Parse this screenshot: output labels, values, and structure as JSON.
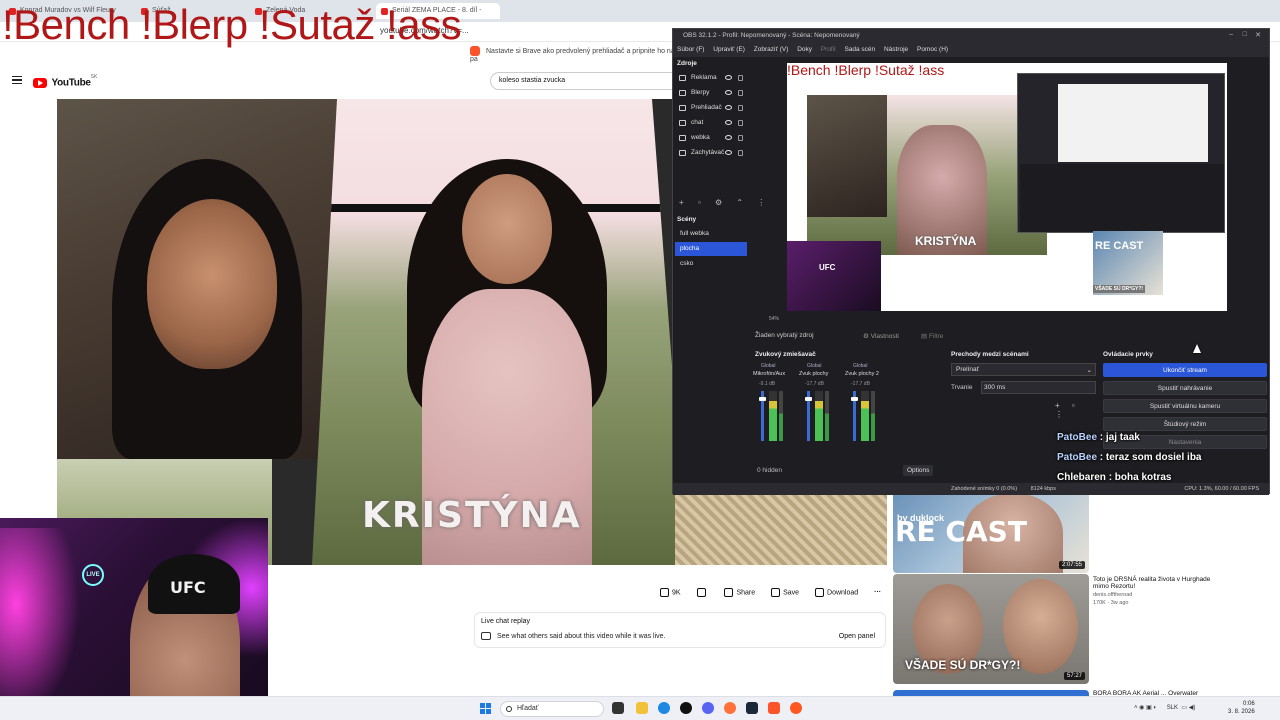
{
  "overlay_title": "!Bench !Blerp !Sutaž !ass",
  "browser": {
    "tabs": [
      {
        "label": "Konrad Muradov vs Wilf Fleury"
      },
      {
        "label": "Súťaž"
      },
      {
        "label": "Zelená Voda"
      },
      {
        "label": "jaro"
      },
      {
        "label": "Seriál ZEMA PLACE - 8. díl -"
      }
    ],
    "url": "youtube.com/watch?v=...",
    "infobar_text": "Nastavte si Brave ako predvolený prehliadač a pripnite ho na pa"
  },
  "youtube": {
    "logo_text": "YouTube",
    "logo_cc": "SK",
    "search_value": "koleso stastia zvucka",
    "video_overlay_name": "KRISTÝNA",
    "actions": {
      "likes": "9K",
      "share": "Share",
      "save": "Save",
      "download": "Download"
    },
    "chat_replay": {
      "title": "Live chat replay",
      "desc": "See what others said about this video while it was live.",
      "open": "Open panel"
    },
    "sidebar": [
      {
        "by": "by duklock",
        "big": "RE CAST",
        "duration": "2:07:55"
      },
      {
        "caption": "VŠADE SÚ DR*GY?!",
        "duration": "57:27",
        "title": "Toto je DRSNÁ realita života v Hurghade mimo Rezortu!",
        "channel": "denis.offtheroad",
        "meta": "170K · 3w ago"
      },
      {
        "title": "BORA BORA AK Aerial ... Overwater"
      }
    ]
  },
  "obs": {
    "title": "OBS 32.1.2 - Profil: Nepomenovaný - Scéna: Nepomenovaný",
    "menu": [
      "Súbor (F)",
      "Upraviť (E)",
      "Zobraziť (V)",
      "Doky",
      "Profil",
      "Sada scén",
      "Nástroje",
      "Pomoc (H)"
    ],
    "sources_title": "Zdroje",
    "sources": [
      "Reklama",
      "Blerpy",
      "Prehliadač",
      "chat",
      "webka",
      "Zachytávač"
    ],
    "scenes_title": "Scény",
    "scenes": [
      "full webka",
      "plocha",
      "csko"
    ],
    "preview": {
      "title": "!Bench !Blerp !Sutaž !ass",
      "name": "KRISTÝNA",
      "cam": "UFC",
      "recast": "RE CAST",
      "vsade": "VŠADE SÚ DR*GY?!"
    },
    "zoom": "54%",
    "no_source": "Žiaden vybratý zdroj",
    "properties": "Vlastnosti",
    "filters": "Filtre",
    "mixer": {
      "title": "Zvukový zmiešavač",
      "channels": [
        {
          "group": "Global",
          "name": "Mikrofón/Aux",
          "db": "-9.1 dB"
        },
        {
          "group": "Global",
          "name": "Zvuk plochy",
          "db": "-17.7 dB"
        },
        {
          "group": "Global",
          "name": "Zvuk plochy 2",
          "db": "-17.7 dB"
        }
      ],
      "hidden": "0 hidden",
      "options": "Options"
    },
    "transitions": {
      "title": "Prechody medzi scénami",
      "selected": "Prelínať",
      "duration_label": "Trvanie",
      "duration_value": "300 ms"
    },
    "controls": {
      "title": "Ovládacie prvky",
      "buttons": [
        "Ukončiť stream",
        "Spustiť nahrávanie",
        "Spustiť virtuálnu kameru",
        "Štúdiový režim",
        "Nastavenia"
      ]
    },
    "status": {
      "dropped": "Zahodené snímky 0 (0.0%)",
      "bitrate": "8124 kbps",
      "cpu": "CPU: 1.3%, 60.00 / 60.00 FPS"
    }
  },
  "chat": [
    {
      "name": "PatoBee",
      "msg": ": jaj taak"
    },
    {
      "name": "PatoBee",
      "msg": ": teraz som dosiel iba"
    },
    {
      "name": "Chlebaren",
      "msg": ": boha kotras"
    }
  ],
  "webcam": {
    "cap_text": "UFC",
    "neon": "LIVE"
  },
  "taskbar": {
    "search": "Hľadať",
    "lang": "SLK",
    "time": "0:06",
    "date": "3. 8. 2026"
  },
  "colors": {
    "accent": "#2b56d8",
    "overlay_red": "#b01818",
    "youtube_red": "#ff0000"
  }
}
